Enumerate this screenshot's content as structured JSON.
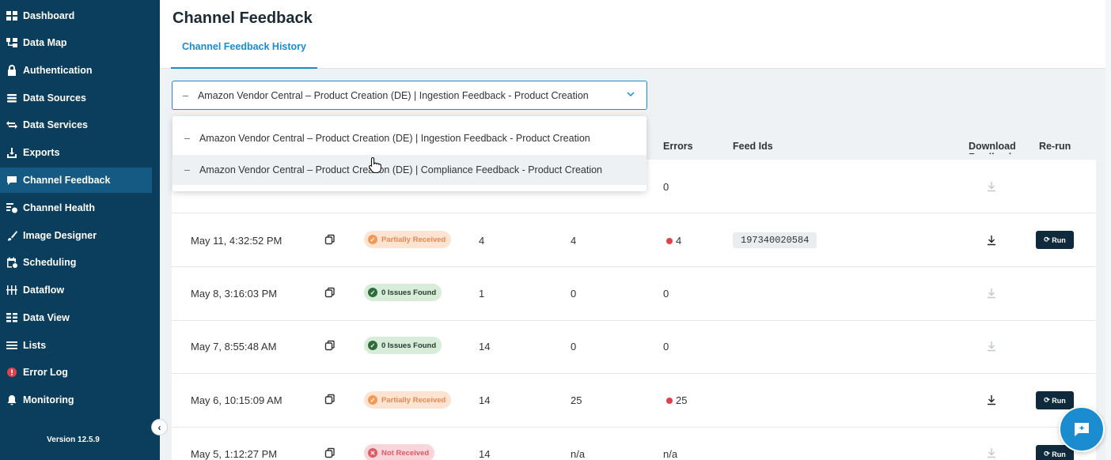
{
  "sidebar": {
    "items": [
      {
        "label": "Dashboard",
        "icon": "dashboard-icon"
      },
      {
        "label": "Data Map",
        "icon": "data-map-icon"
      },
      {
        "label": "Authentication",
        "icon": "lock-icon"
      },
      {
        "label": "Data Sources",
        "icon": "database-icon"
      },
      {
        "label": "Data Services",
        "icon": "arrows-icon"
      },
      {
        "label": "Exports",
        "icon": "export-icon"
      },
      {
        "label": "Channel Feedback",
        "icon": "chat-icon"
      },
      {
        "label": "Channel Health",
        "icon": "health-icon"
      },
      {
        "label": "Image Designer",
        "icon": "brush-icon"
      },
      {
        "label": "Scheduling",
        "icon": "calendar-icon"
      },
      {
        "label": "Dataflow",
        "icon": "dataflow-icon"
      },
      {
        "label": "Data View",
        "icon": "table-icon"
      },
      {
        "label": "Lists",
        "icon": "list-icon"
      },
      {
        "label": "Error Log",
        "icon": "error-icon"
      },
      {
        "label": "Monitoring",
        "icon": "bell-icon"
      }
    ],
    "active": "Channel Feedback",
    "version": "Version 12.5.9"
  },
  "header": {
    "title": "Channel Feedback",
    "tab": "Channel Feedback History"
  },
  "select": {
    "dash": "–",
    "value": "Amazon Vendor Central – Product Creation (DE) | Ingestion Feedback - Product Creation"
  },
  "menu": {
    "items": [
      "Amazon Vendor Central – Product Creation (DE) | Ingestion Feedback - Product Creation",
      "Amazon Vendor Central – Product Creation (DE) | Compliance Feedback - Product Creation"
    ]
  },
  "table": {
    "headers": {
      "errors": "Errors",
      "feed_ids": "Feed Ids",
      "download": "Download Feedback",
      "rerun": "Re-run"
    },
    "first_row_errors": "0",
    "rows": [
      {
        "date": "May 11, 4:32:52 PM",
        "status": "Partially Received",
        "status_kind": "partial",
        "c1": "4",
        "c2": "4",
        "errors": "4",
        "error_flag": true,
        "feed_id": "197340020584",
        "download_enabled": true,
        "run": "Run"
      },
      {
        "date": "May 8, 3:16:03 PM",
        "status": "0 Issues Found",
        "status_kind": "ok",
        "c1": "1",
        "c2": "0",
        "errors": "0",
        "error_flag": false,
        "feed_id": "",
        "download_enabled": false,
        "run": ""
      },
      {
        "date": "May 7, 8:55:48 AM",
        "status": "0 Issues Found",
        "status_kind": "ok",
        "c1": "14",
        "c2": "0",
        "errors": "0",
        "error_flag": false,
        "feed_id": "",
        "download_enabled": false,
        "run": ""
      },
      {
        "date": "May 6, 10:15:09 AM",
        "status": "Partially Received",
        "status_kind": "partial",
        "c1": "14",
        "c2": "25",
        "errors": "25",
        "error_flag": true,
        "feed_id": "",
        "download_enabled": true,
        "run": "Run"
      },
      {
        "date": "May 5, 1:12:27 PM",
        "status": "Not Received",
        "status_kind": "not",
        "c1": "14",
        "c2": "n/a",
        "errors": "n/a",
        "error_flag": false,
        "feed_id": "",
        "download_enabled": false,
        "run": "Run"
      }
    ]
  },
  "colors": {
    "sidebar": "#0b3d5c",
    "accent": "#1a8ccf",
    "run_button": "#0f2a3d"
  }
}
